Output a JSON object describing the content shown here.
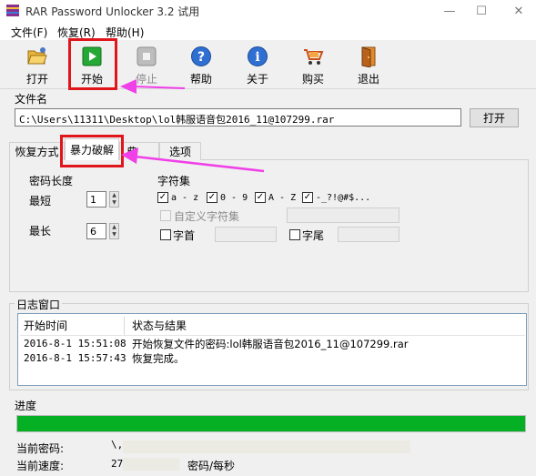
{
  "window": {
    "title": "RAR Password Unlocker 3.2 试用"
  },
  "menu": [
    "文件(F)",
    "恢复(R)",
    "帮助(H)"
  ],
  "toolbar": {
    "open": "打开",
    "start": "开始",
    "stop": "停止",
    "help": "帮助",
    "about": "关于",
    "buy": "购买",
    "exit": "退出"
  },
  "file": {
    "group_label": "文件名",
    "path": "C:\\Users\\11311\\Desktop\\lol韩服语音包2016_11@107299.rar",
    "open_button": "打开"
  },
  "tabs": [
    "恢复方式",
    "暴力破解",
    "典",
    "选项"
  ],
  "brute": {
    "length_label": "密码长度",
    "min_label": "最短",
    "min_value": "1",
    "max_label": "最长",
    "max_value": "6",
    "charset_label": "字符集",
    "charsets": [
      "a - z",
      "0 - 9",
      "A - Z",
      "-_?!@#$..."
    ],
    "custom_charset": "自定义字符集",
    "prefix": "字首",
    "suffix": "字尾"
  },
  "log": {
    "group_label": "日志窗口",
    "col_time": "开始时间",
    "col_status": "状态与结果",
    "rows": [
      {
        "time": "2016-8-1 15:51:08",
        "status": "开始恢复文件的密码:lol韩服语音包2016_11@107299.rar"
      },
      {
        "time": "2016-8-1 15:57:43",
        "status": "恢复完成。"
      }
    ]
  },
  "progress": {
    "group_label": "进度",
    "percent": 100,
    "current_password_label": "当前密码:",
    "current_password": "\\,",
    "current_speed_label": "当前速度:",
    "current_speed": "27",
    "speed_unit": "密码/每秒"
  },
  "colors": {
    "progress": "#06b025",
    "highlight": "#e0161c",
    "arrow": "#f040e8"
  }
}
